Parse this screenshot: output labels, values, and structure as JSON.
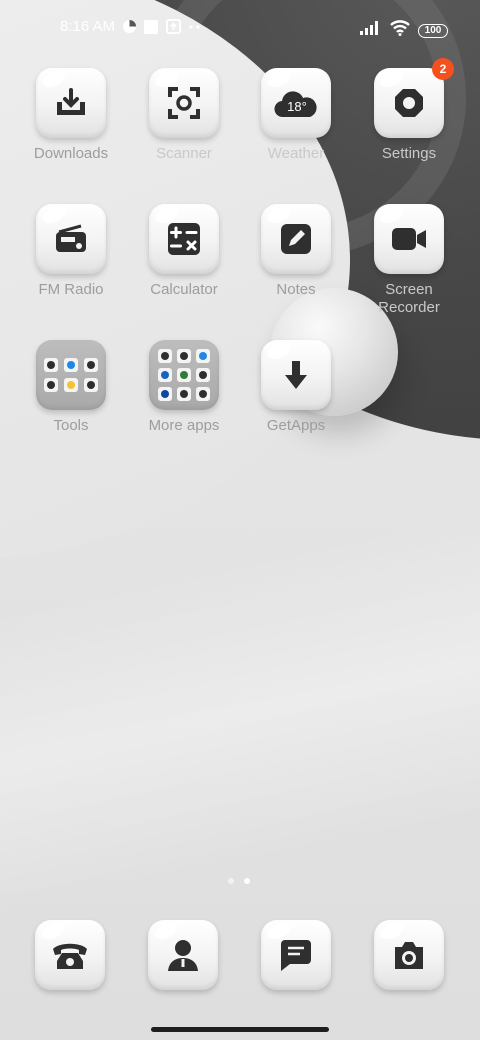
{
  "status_bar": {
    "time": "8:16 AM",
    "battery": "100",
    "icons": [
      "data-saver-icon",
      "notification-square-icon",
      "upload-box-icon",
      "more-dots-icon",
      "signal-icon",
      "wifi-icon",
      "battery-icon"
    ]
  },
  "apps": [
    {
      "id": "downloads",
      "label": "Downloads",
      "icon": "download-icon"
    },
    {
      "id": "scanner",
      "label": "Scanner",
      "icon": "scanner-icon"
    },
    {
      "id": "weather",
      "label": "Weather",
      "icon": "cloud-icon",
      "icon_text": "18°"
    },
    {
      "id": "settings",
      "label": "Settings",
      "icon": "gear-icon",
      "badge": "2"
    },
    {
      "id": "fm-radio",
      "label": "FM Radio",
      "icon": "radio-icon"
    },
    {
      "id": "calculator",
      "label": "Calculator",
      "icon": "calculator-icon"
    },
    {
      "id": "notes",
      "label": "Notes",
      "icon": "notes-icon"
    },
    {
      "id": "screen-recorder",
      "label": "Screen Recorder",
      "icon": "video-camera-icon"
    },
    {
      "id": "tools",
      "label": "Tools",
      "icon": "folder-icon"
    },
    {
      "id": "more-apps",
      "label": "More apps",
      "icon": "folder-icon"
    },
    {
      "id": "getapps",
      "label": "GetApps",
      "icon": "arrow-down-icon"
    }
  ],
  "folders": {
    "tools_minis": [
      "#2e2e2e",
      "#1e88e5",
      "#2e2e2e",
      "#2e2e2e",
      "#f4c430",
      "#2e2e2e"
    ],
    "more_apps_minis": [
      "#2e2e2e",
      "#2e2e2e",
      "#1e88e5",
      "#1565c0",
      "#2e7d32",
      "#2e2e2e",
      "#0d47a1",
      "#2e2e2e",
      "#2e2e2e"
    ]
  },
  "dock": [
    {
      "id": "phone",
      "icon": "telephone-icon"
    },
    {
      "id": "contacts",
      "icon": "person-icon"
    },
    {
      "id": "messages",
      "icon": "message-icon"
    },
    {
      "id": "camera",
      "icon": "camera-icon"
    }
  ],
  "page_indicator": {
    "pages": 2,
    "active": 2
  },
  "colors": {
    "badge": "#f4511e",
    "icon_glyph": "#2f2f2f",
    "label": "#9d9d9d"
  }
}
